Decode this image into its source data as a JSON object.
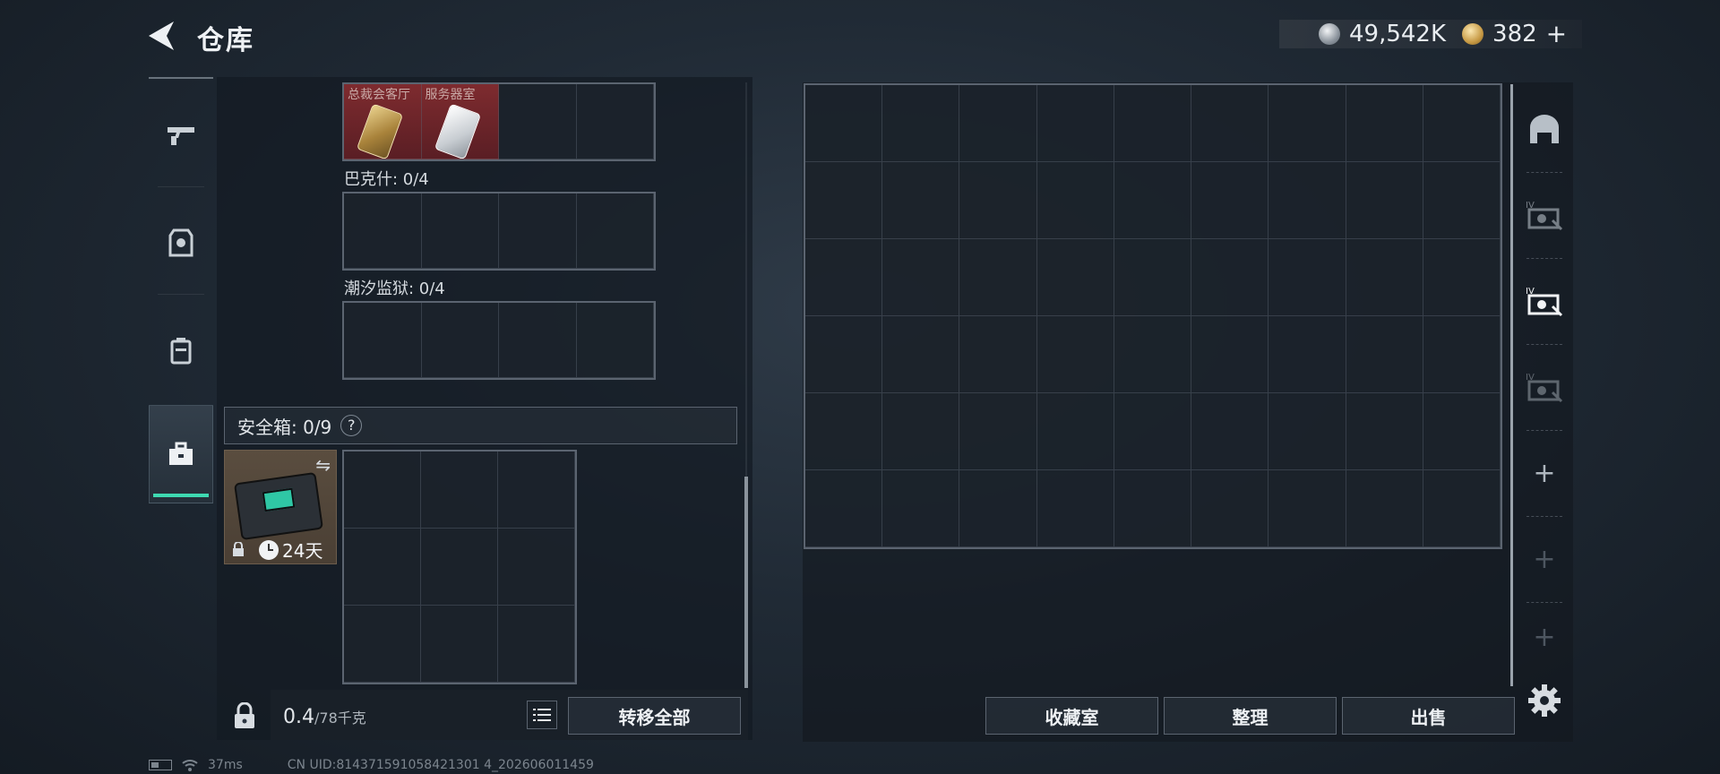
{
  "header": {
    "title": "仓库",
    "back_icon": "chevron-left-icon"
  },
  "currency": {
    "silver_amount": "49,542K",
    "gold_amount": "382",
    "add_label": "+",
    "silver_icon": "silver-coin-icon",
    "gold_icon": "gold-coin-icon"
  },
  "left_nav": {
    "items": [
      {
        "icon": "gun-icon",
        "active": false
      },
      {
        "icon": "armor-vest-icon",
        "active": false
      },
      {
        "icon": "backpack-icon",
        "active": false
      },
      {
        "icon": "toolbox-icon",
        "active": true
      }
    ]
  },
  "keycards": {
    "items": [
      {
        "tag": "总裁会客厅",
        "style": "gold-card"
      },
      {
        "tag": "服务器室",
        "style": "white-card"
      }
    ]
  },
  "slots": {
    "bark_label": "巴克什: 0/4",
    "tide_label": "潮汐监狱: 0/4"
  },
  "safebox": {
    "label": "安全箱:  0/9",
    "help": "?",
    "swap_icon": "⇋",
    "timer": "24天"
  },
  "weight": {
    "current": "0.4",
    "capacity": "/78千克"
  },
  "buttons": {
    "transfer_all": "转移全部",
    "collection": "收藏室",
    "sort": "整理",
    "sell": "出售"
  },
  "stash_tabs": {
    "plus": "+"
  },
  "status": {
    "ping": "37ms",
    "uid": "CN UID:814371591058421301 4_202606011459"
  },
  "colors": {
    "accent": "#3ed9b2",
    "keycard_bg": "#7e2b2f",
    "safebox_bg": "#5a4d3f"
  }
}
